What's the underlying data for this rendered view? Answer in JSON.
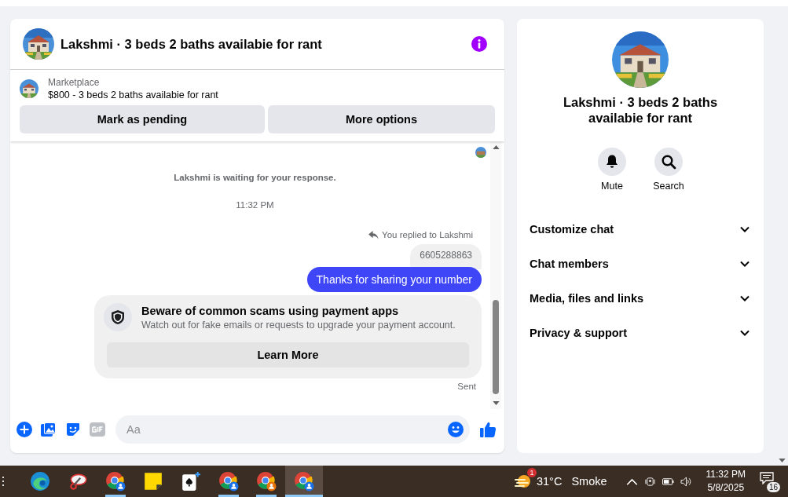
{
  "header": {
    "title": "Lakshmi · 3 beds 2 baths availabie for rant"
  },
  "listing": {
    "source": "Marketplace",
    "title": "$800 - 3 beds 2 baths availabie for rant",
    "buttons": [
      "Mark as pending",
      "More options"
    ]
  },
  "messages": [
    {
      "kind": "notice",
      "text": "Lakshmi is waiting for your response."
    },
    {
      "kind": "time",
      "text": "11:32 PM"
    },
    {
      "kind": "reply_label",
      "text": "You replied to Lakshmi"
    },
    {
      "kind": "quoted",
      "text": "6605288863"
    },
    {
      "kind": "outgoing",
      "text": "Thanks for sharing your number"
    },
    {
      "kind": "warning",
      "title": "Beware of common scams using payment apps",
      "text": "Watch out for fake emails or requests to upgrade your payment account.",
      "button": "Learn More"
    },
    {
      "kind": "status",
      "text": "Sent"
    }
  ],
  "composer": {
    "placeholder": "Aa"
  },
  "details": {
    "title": "Lakshmi · 3 beds 2 baths availabie for rant",
    "actions": [
      {
        "kind": "mute",
        "label": "Mute"
      },
      {
        "kind": "search",
        "label": "Search"
      }
    ],
    "sections": [
      {
        "label": "Customize chat",
        "expanded": false
      },
      {
        "label": "Chat members",
        "expanded": false
      },
      {
        "label": "Media, files and links",
        "expanded": false
      },
      {
        "label": "Privacy & support",
        "expanded": false
      }
    ]
  },
  "taskbar": {
    "apps": [
      {
        "kind": "edge",
        "running": false,
        "selected": false
      },
      {
        "kind": "snip",
        "running": false,
        "selected": false
      },
      {
        "kind": "chrome",
        "running": true,
        "selected": false,
        "color": "#1a73e8"
      },
      {
        "kind": "notes",
        "running": false,
        "selected": false
      },
      {
        "kind": "cards",
        "running": false,
        "selected": false
      },
      {
        "kind": "chrome",
        "running": true,
        "selected": false,
        "color": "#1a73e8"
      },
      {
        "kind": "chrome",
        "running": true,
        "selected": false,
        "color": "#e8710a"
      },
      {
        "kind": "chrome",
        "running": true,
        "selected": true,
        "color": "#1a73e8"
      }
    ],
    "weather": {
      "temperature": "31°C",
      "condition": "Smoke",
      "badge": "1"
    },
    "time": "11:32 PM",
    "date": "5/8/2025",
    "notifications": "16"
  }
}
